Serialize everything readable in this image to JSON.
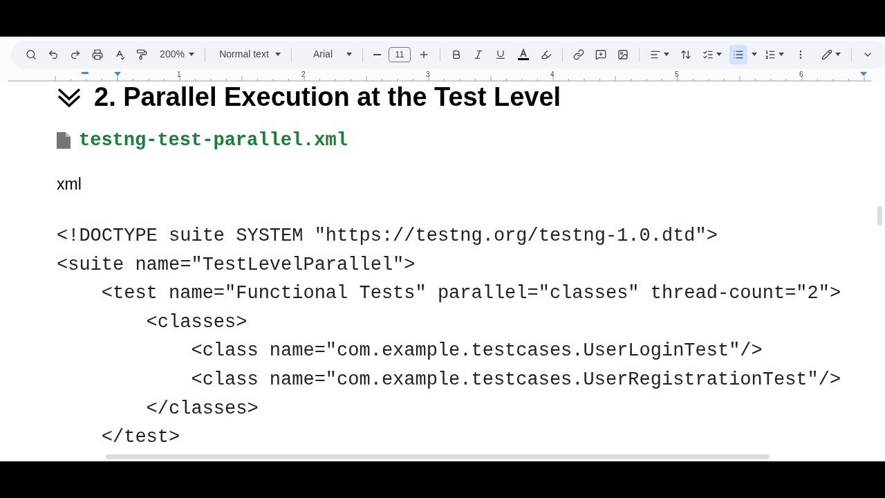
{
  "toolbar": {
    "zoom": "200%",
    "style": "Normal text",
    "font": "Arial",
    "font_size": "11",
    "bulleted_list_selected": true
  },
  "ruler": {
    "numbers": [
      "1",
      "2",
      "3",
      "4",
      "5",
      "6"
    ]
  },
  "document": {
    "heading": "2. Parallel Execution at the Test Level",
    "file_name": "testng-test-parallel.xml",
    "language": "xml",
    "code_lines": [
      "<!DOCTYPE suite SYSTEM \"https://testng.org/testng-1.0.dtd\">",
      "<suite name=\"TestLevelParallel\">",
      "    <test name=\"Functional Tests\" parallel=\"classes\" thread-count=\"2\">",
      "        <classes>",
      "            <class name=\"com.example.testcases.UserLoginTest\"/>",
      "            <class name=\"com.example.testcases.UserRegistrationTest\"/>",
      "        </classes>",
      "    </test>"
    ]
  }
}
